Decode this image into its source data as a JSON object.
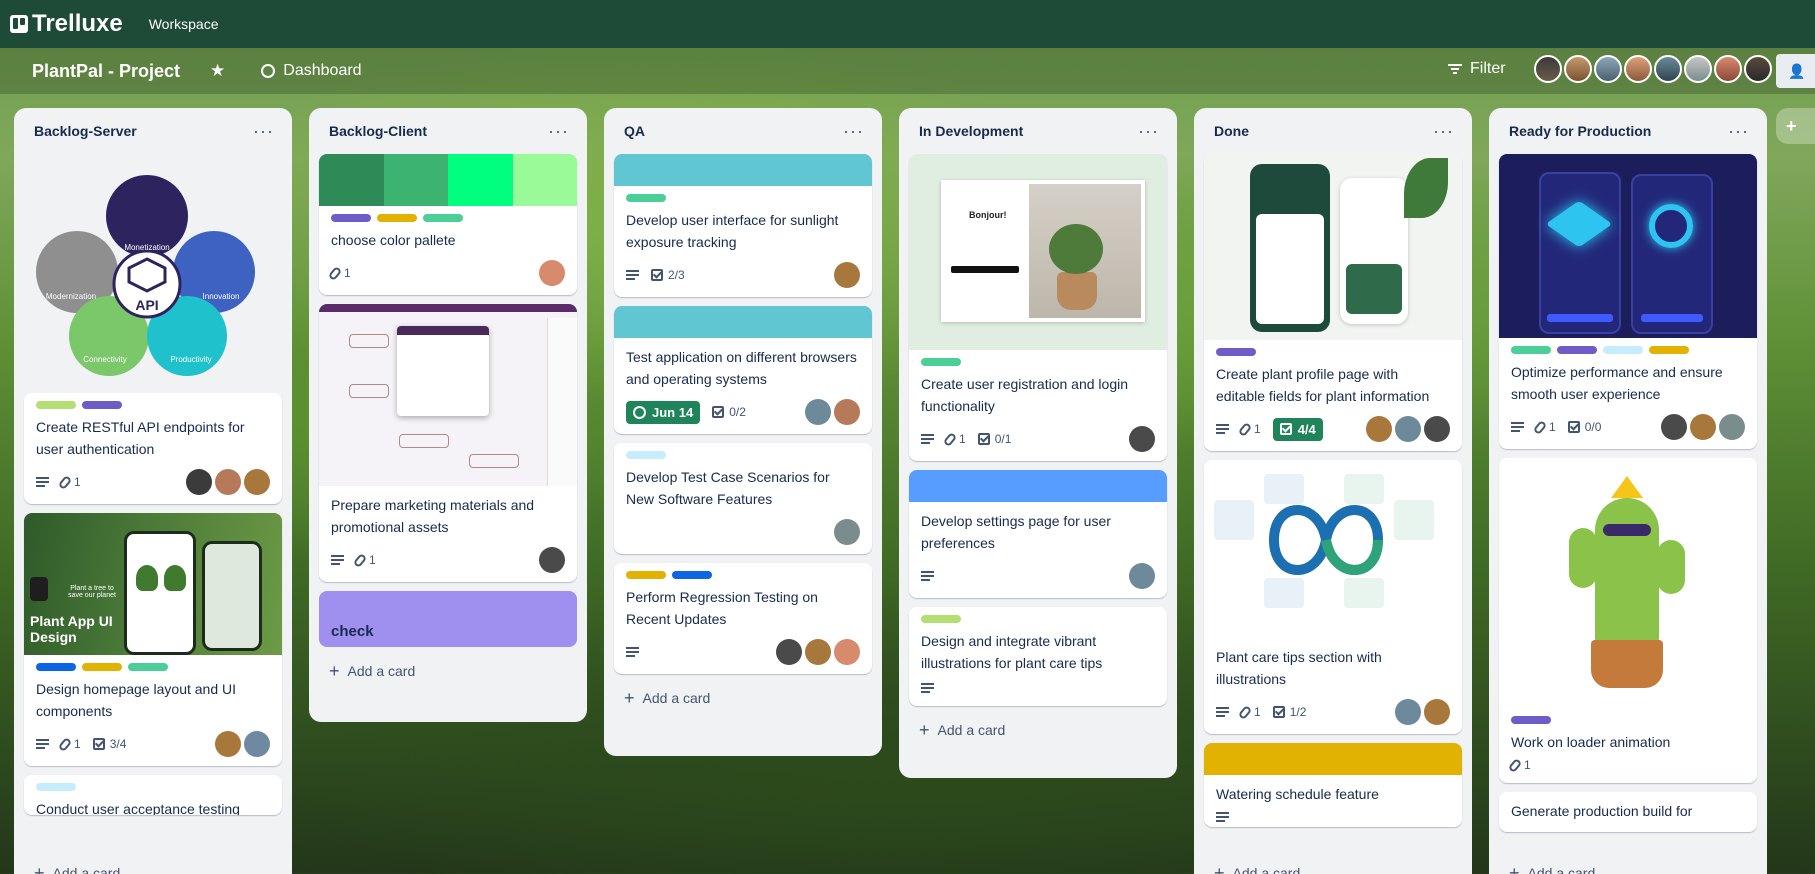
{
  "app": {
    "name": "Trelluxe",
    "workspace": "Workspace"
  },
  "board": {
    "title": "PlantPal - Project",
    "dashboard": "Dashboard",
    "filter": "Filter"
  },
  "colors": {
    "green": "#4bce97",
    "purple": "#6e5dc6",
    "yellow": "#e2b203",
    "blue": "#0c66e4",
    "teal": "#60c6d2",
    "lime": "#b3df72",
    "sky": "#c6edfb",
    "lightgreen": "#94c748"
  },
  "lists": [
    {
      "name": "Backlog-Server",
      "add": "Add a card",
      "cards": [
        {
          "title": "Create RESTful API endpoints for user authentication",
          "attach": "1"
        },
        {
          "cover_text": "Plant App UI Design",
          "cover_small": "Plant a tree to save our planet",
          "title": "Design homepage layout and UI components",
          "attach": "1",
          "check": "3/4"
        },
        {
          "title": "Conduct user acceptance testing"
        }
      ],
      "api_labels": [
        "Monetization",
        "Modernization",
        "Innovation",
        "API",
        "Connectivity",
        "Productivity"
      ]
    },
    {
      "name": "Backlog-Client",
      "add": "Add a card",
      "cards": [
        {
          "title": "choose color pallete",
          "attach": "1"
        },
        {
          "title": "Prepare marketing materials and promotional assets",
          "attach": "1"
        },
        {
          "title": "check"
        }
      ]
    },
    {
      "name": "QA",
      "add": "Add a card",
      "cards": [
        {
          "title": "Develop user interface for sunlight exposure tracking",
          "check": "2/3"
        },
        {
          "title": "Test application on different browsers and operating systems",
          "due": "Jun 14",
          "check": "0/2"
        },
        {
          "title": "Develop Test Case Scenarios for New Software Features"
        },
        {
          "title": "Perform Regression Testing on Recent Updates"
        }
      ]
    },
    {
      "name": "In Development",
      "add": "Add a card",
      "cards": [
        {
          "title": "Create user registration and login functionality",
          "attach": "1",
          "check": "0/1",
          "cover_text": "Bonjour!"
        },
        {
          "title": "Develop settings page for user preferences"
        },
        {
          "title": "Design and integrate vibrant illustrations for plant care tips"
        }
      ]
    },
    {
      "name": "Done",
      "add": "Add a card",
      "cards": [
        {
          "title": "Create plant profile page with editable fields for plant information",
          "attach": "1",
          "check": "4/4"
        },
        {
          "title": "Plant care tips section with illustrations",
          "attach": "1",
          "check": "1/2"
        },
        {
          "title": "Watering schedule feature"
        }
      ]
    },
    {
      "name": "Ready for Production",
      "add": "Add a card",
      "cards": [
        {
          "title": "Optimize performance and ensure smooth user experience",
          "attach": "1",
          "check": "0/0"
        },
        {
          "title": "Work on loader animation",
          "attach": "1"
        },
        {
          "title": "Generate production build for"
        }
      ]
    }
  ]
}
